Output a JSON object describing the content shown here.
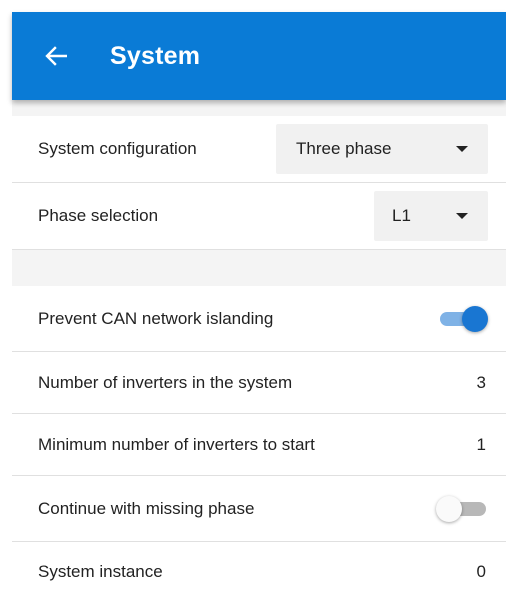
{
  "header": {
    "title": "System",
    "back_icon": "arrow-left-icon"
  },
  "colors": {
    "app_bar": "#0a7bd6",
    "accent": "#1976d2",
    "section_gap": "#f4f4f4"
  },
  "group1": {
    "system_configuration": {
      "label": "System configuration",
      "value": "Three phase"
    },
    "phase_selection": {
      "label": "Phase selection",
      "value": "L1"
    }
  },
  "group2": {
    "prevent_can_islanding": {
      "label": "Prevent CAN network islanding",
      "enabled": true
    },
    "number_of_inverters": {
      "label": "Number of inverters in the system",
      "value": "3"
    },
    "min_inverters_to_start": {
      "label": "Minimum number of inverters to start",
      "value": "1"
    },
    "continue_missing_phase": {
      "label": "Continue with missing phase",
      "enabled": false
    },
    "system_instance": {
      "label": "System instance",
      "value": "0"
    }
  }
}
